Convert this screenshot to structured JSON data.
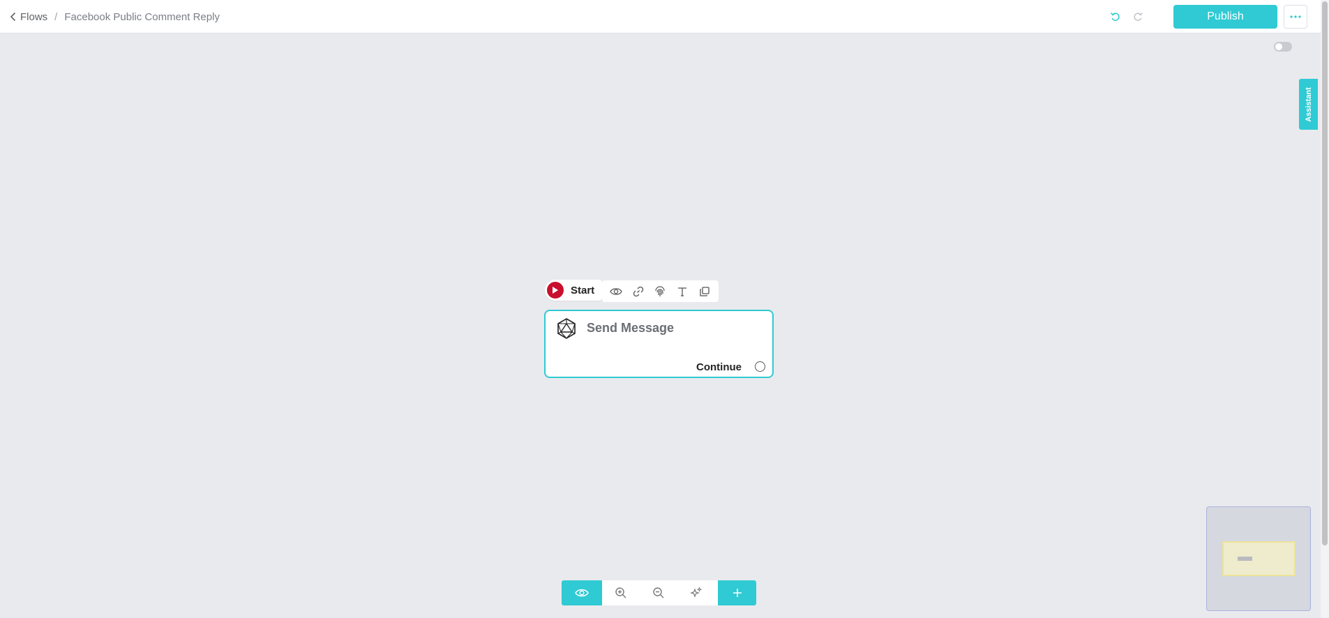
{
  "header": {
    "breadcrumb": {
      "back_label": "Flows",
      "separator": "/",
      "current": "Facebook Public Comment Reply"
    },
    "undo_icon": "undo-icon",
    "redo_icon": "redo-icon",
    "publish_label": "Publish",
    "more_icon": "ellipsis-icon"
  },
  "side": {
    "assistant_label": "Assistant",
    "toggle_on": false
  },
  "canvas": {
    "start_label": "Start",
    "toolbar_icons": [
      "eye-icon",
      "link-icon",
      "fingerprint-icon",
      "text-icon",
      "copy-icon"
    ],
    "node": {
      "title": "Send Message",
      "continue_label": "Continue",
      "icon": "icosahedron-icon"
    }
  },
  "bottom_toolbar": [
    "preview-eye-icon",
    "zoom-in-icon",
    "zoom-out-icon",
    "auto-arrange-icon",
    "plus-icon"
  ],
  "colors": {
    "accent": "#2fcad3",
    "start": "#c8102e",
    "canvas": "#e9eaee"
  }
}
